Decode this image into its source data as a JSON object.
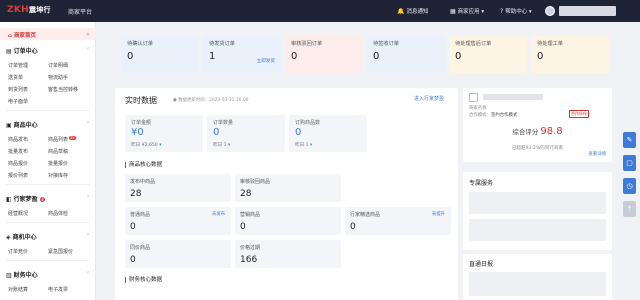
{
  "topbar": {
    "logo_zk": "ZKH",
    "logo_rest": "震坤行",
    "platform": "商家平台",
    "msg": "消息通知",
    "merchant": "商家应用 ▾",
    "help": "帮助中心 ▾"
  },
  "sidebar": {
    "home": "商家首页",
    "sections": [
      {
        "title": "订单中心",
        "items": [
          "订单管理",
          "订单明细",
          "送货单",
          "物流助手",
          "到货列表",
          "客售当控转移",
          "电子面单"
        ]
      },
      {
        "title": "商品中心",
        "items": [
          "商品发布",
          "商品列表",
          "批量发布",
          "商品草稿",
          "商品报价",
          "批量报价",
          "报价列表",
          "对接库存"
        ],
        "badge": "39"
      },
      {
        "title": "行家梦盈",
        "num": "4",
        "items": [
          "经营概况",
          "商品体检"
        ]
      },
      {
        "title": "商机中心",
        "items": [
          "订单竞价",
          "紧急国报价"
        ]
      },
      {
        "title": "财务中心",
        "items": [
          "对账结算",
          "电子发票"
        ]
      }
    ]
  },
  "topcards": [
    {
      "label": "待确认订单",
      "value": "0",
      "link": ""
    },
    {
      "label": "待发货订单",
      "value": "1",
      "link": "立即发货"
    },
    {
      "label": "审核驳回订单",
      "value": "0",
      "link": ""
    },
    {
      "label": "待签收订单",
      "value": "0",
      "link": ""
    },
    {
      "label": "待处理售后订单",
      "value": "0",
      "link": ""
    },
    {
      "label": "待处理工单",
      "value": "0",
      "link": ""
    }
  ],
  "realtime": {
    "title": "实时数据",
    "subtitle": "● 数据更新时间：2023-03-31 16:09",
    "link": "进入行家梦盈",
    "metrics": [
      {
        "label": "订单金额",
        "value": "¥0",
        "cmp": "昨日 ¥2,650",
        "arrow": "▾"
      },
      {
        "label": "订单数量",
        "value": "0",
        "cmp": "昨日 1",
        "arrow": "▾"
      },
      {
        "label": "订购商品数",
        "value": "0",
        "cmp": "昨日 1",
        "arrow": "▾"
      }
    ],
    "goods_title": "商品核心数据",
    "goods": [
      {
        "label": "发布中商品",
        "value": "28",
        "action": ""
      },
      {
        "label": "审核驳回商品",
        "value": "28",
        "action": ""
      },
      {
        "label": "普通商品",
        "value": "0",
        "action": "去发布"
      },
      {
        "label": "营销商品",
        "value": "0",
        "action": ""
      },
      {
        "label": "行家精选商品",
        "value": "0",
        "action": "去提升"
      },
      {
        "label": "同价商品",
        "value": "0",
        "action": ""
      },
      {
        "label": "价格过期",
        "value": "166",
        "action": ""
      }
    ],
    "fin_title": "财务核心数据"
  },
  "right": {
    "shop_line1": "商家名称",
    "shop_line2": "合作模式：",
    "shop_mode": "签约合作模式",
    "shop_badge": "合作伙伴",
    "score_label": "综合评分",
    "score_value": "98.8",
    "beat_text": "已超越93.2%的同行商家",
    "detail_link": "查看详情",
    "service_title": "专属服务",
    "news_title": "直通日报"
  },
  "floats": [
    "edit-icon",
    "clock-icon",
    "arrow-up-icon"
  ]
}
